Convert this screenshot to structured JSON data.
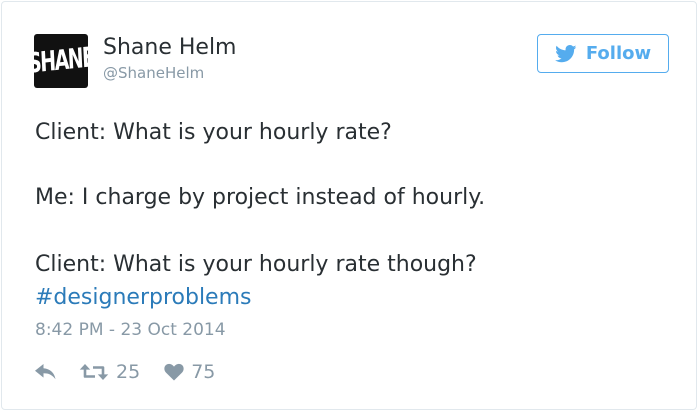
{
  "author": {
    "avatar_text": "SHANE",
    "name": "Shane Helm",
    "handle": "@ShaneHelm"
  },
  "follow_button": {
    "label": "Follow"
  },
  "tweet": {
    "lines": [
      "Client: What is your hourly rate?",
      "Me: I charge by project instead of hourly.",
      "Client: What is your hourly rate though?"
    ],
    "hashtag": "#designerproblems",
    "timestamp": "8:42 PM - 23 Oct 2014"
  },
  "actions": {
    "retweets": "25",
    "likes": "75"
  },
  "colors": {
    "twitter_blue": "#55acee",
    "link_blue": "#2b7bb9",
    "text": "#292f33",
    "muted": "#8899a6",
    "border": "#e1e8ed"
  },
  "icons": {
    "follow": "twitter-bird-icon",
    "reply": "reply-arrow-icon",
    "retweet": "retweet-icon",
    "like": "heart-icon"
  }
}
